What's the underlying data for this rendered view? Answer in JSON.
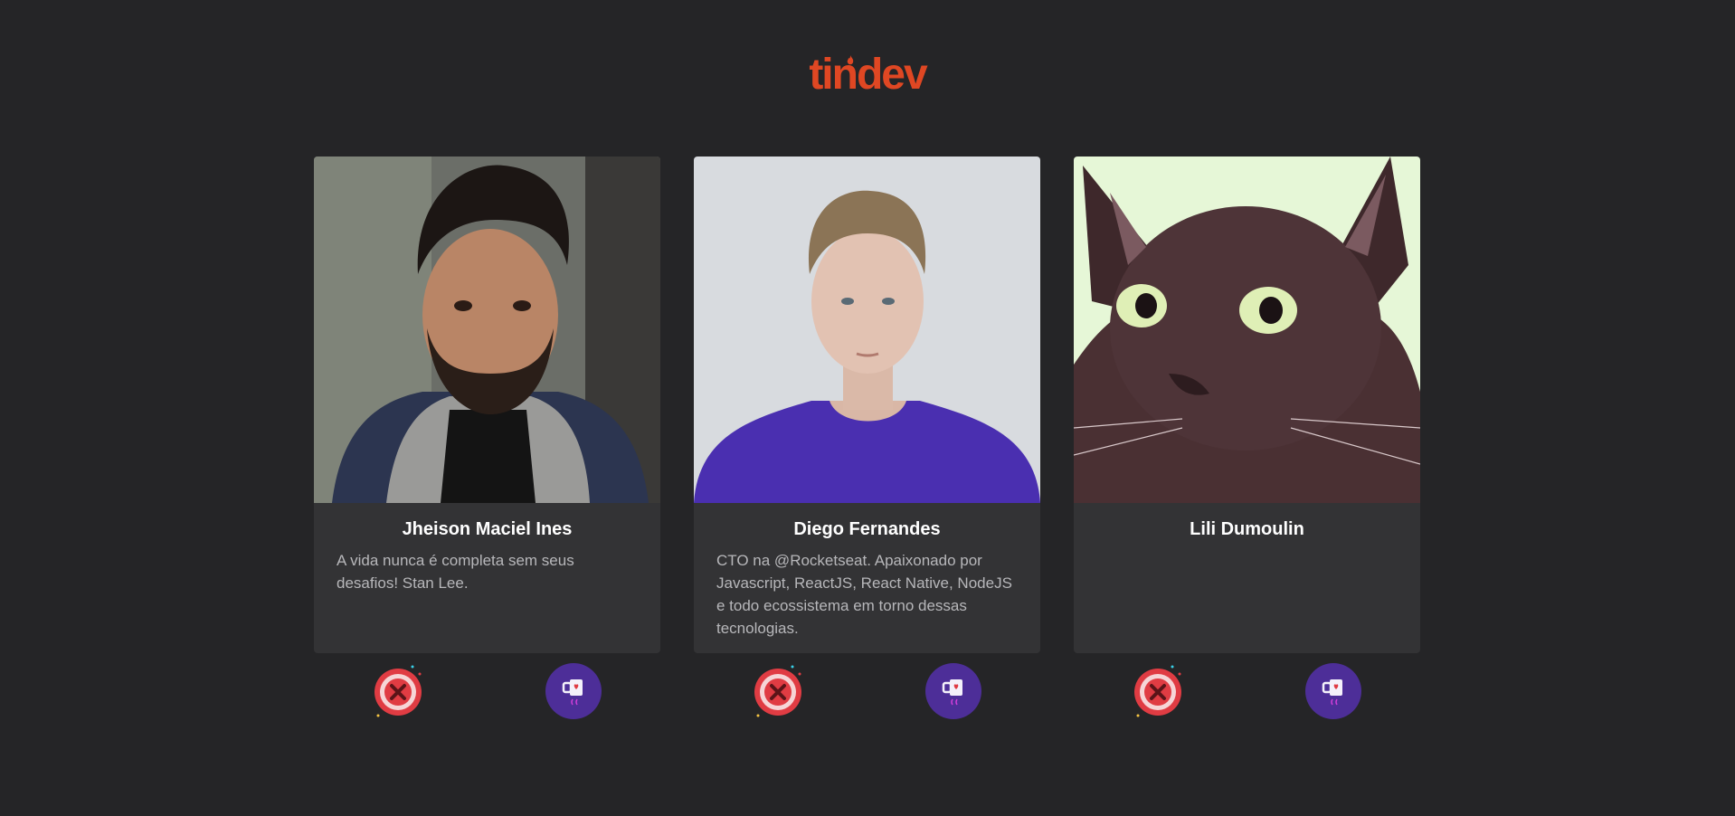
{
  "app": {
    "logo_text": "tindev"
  },
  "colors": {
    "background": "#252527",
    "card": "#333335",
    "brand": "#df4723",
    "dislike": "#e03c43",
    "like": "#4d2e98"
  },
  "devs": [
    {
      "name": "Jheison Maciel Ines",
      "bio": "A vida nunca é completa sem seus desafios! Stan Lee."
    },
    {
      "name": "Diego Fernandes",
      "bio": "CTO na @Rocketseat. Apaixonado por Javascript, ReactJS, React Native, NodeJS e todo ecossistema em torno dessas tecnologias."
    },
    {
      "name": "Lili Dumoulin",
      "bio": ""
    }
  ],
  "icons": {
    "dislike": "dislike-x-icon",
    "like": "like-mug-icon"
  }
}
